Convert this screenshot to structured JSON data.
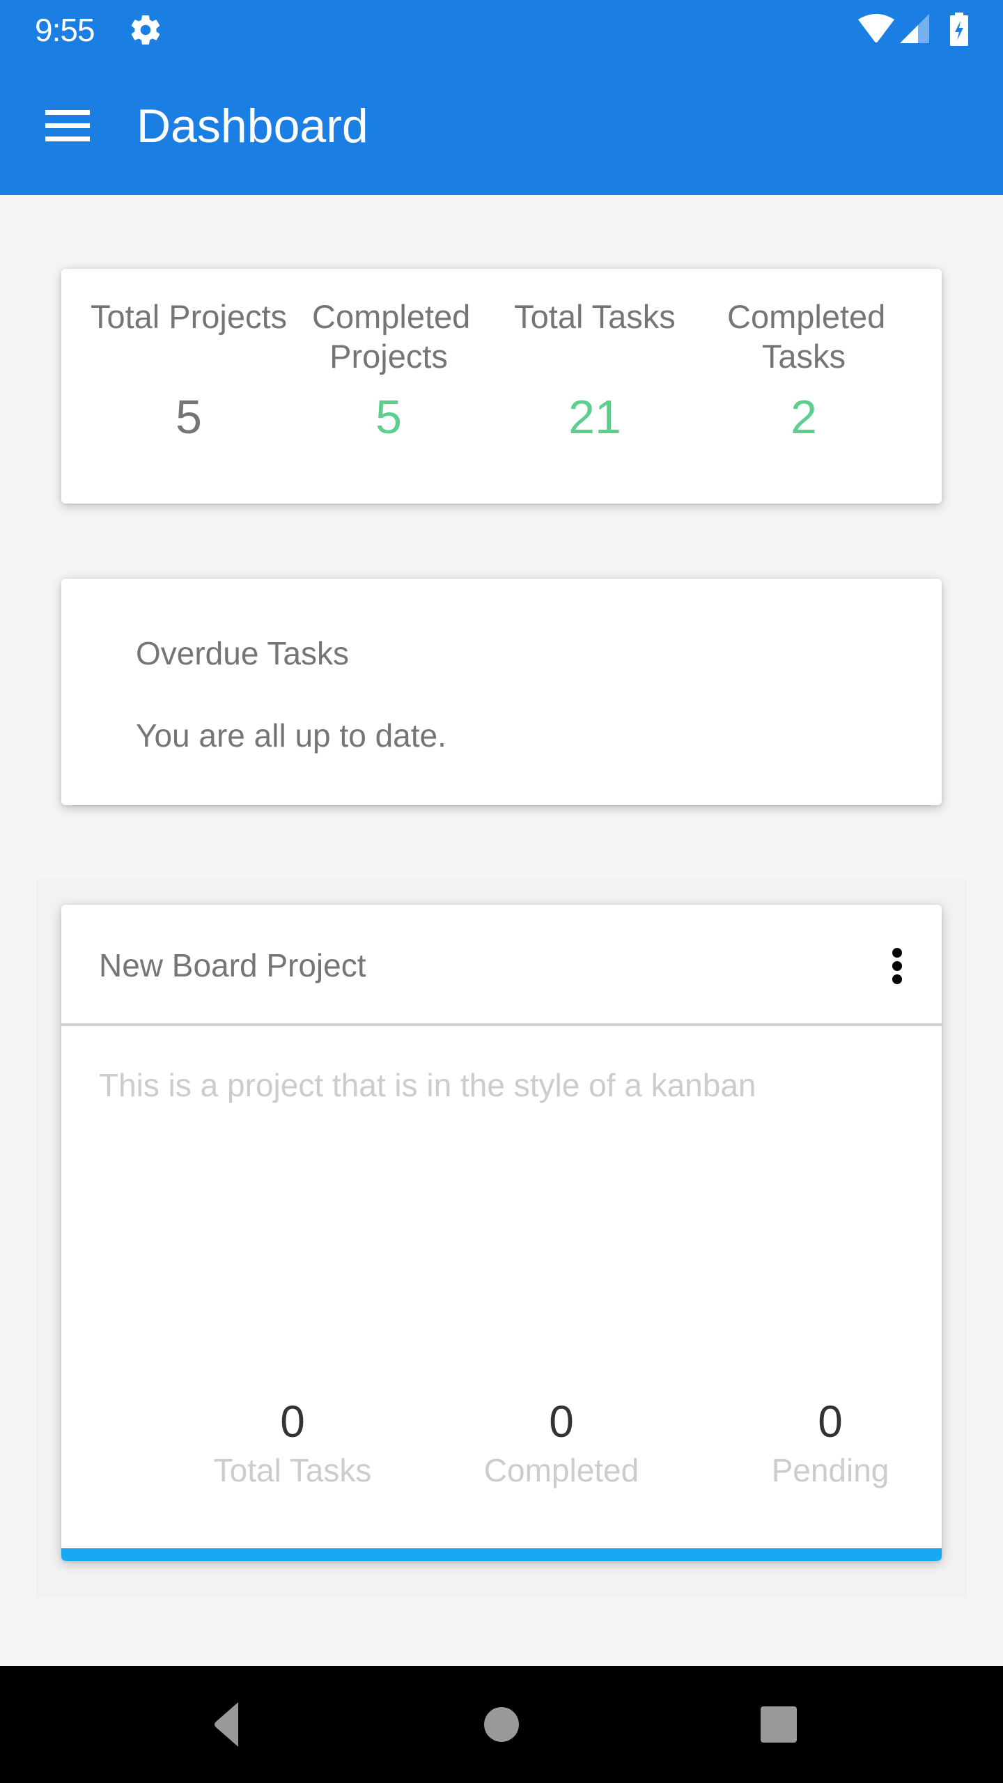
{
  "status_bar": {
    "time": "9:55",
    "icons": [
      "gear-icon",
      "wifi-icon",
      "signal-icon",
      "battery-charging-icon"
    ]
  },
  "app_bar": {
    "title": "Dashboard",
    "menu_icon": "hamburger-menu-icon"
  },
  "colors": {
    "primary": "#1a7ee2",
    "accent_green": "#5ccf8f",
    "progress_blue": "#16a9f2",
    "muted_text": "#757575",
    "faint_text": "#cccccc"
  },
  "summary": {
    "stats": [
      {
        "label": "Total Projects",
        "value": "5",
        "color": "#757575"
      },
      {
        "label": "Completed Projects",
        "value": "5",
        "color": "#5ccf8f"
      },
      {
        "label": "Total Tasks",
        "value": "21",
        "color": "#5ccf8f"
      },
      {
        "label": "Completed Tasks",
        "value": "2",
        "color": "#5ccf8f"
      }
    ]
  },
  "overdue": {
    "title": "Overdue Tasks",
    "message": "You are all up to date."
  },
  "project": {
    "title": "New Board Project",
    "description": "This is a project that is in the style of a kanban",
    "more_icon": "more-vertical-icon",
    "stats": [
      {
        "value": "0",
        "label": "Total Tasks"
      },
      {
        "value": "0",
        "label": "Completed"
      },
      {
        "value": "0",
        "label": "Pending"
      }
    ],
    "progress_fraction": 1.0
  },
  "nav_bar": {
    "buttons": [
      "back-icon",
      "home-icon",
      "recents-icon"
    ]
  }
}
